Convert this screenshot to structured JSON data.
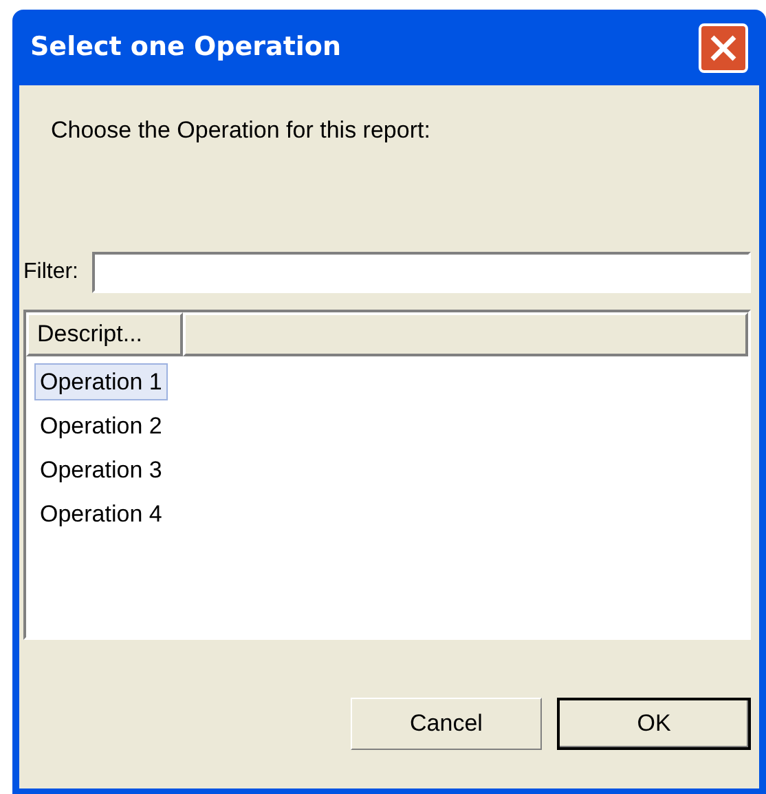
{
  "window": {
    "title": "Select one Operation"
  },
  "prompt": "Choose the Operation for this report:",
  "filter": {
    "label": "Filter:"
  },
  "table": {
    "columns": [
      "Descript..."
    ],
    "rows": [
      {
        "label": "Operation 1",
        "selected": true
      },
      {
        "label": "Operation 2",
        "selected": false
      },
      {
        "label": "Operation 3",
        "selected": false
      },
      {
        "label": "Operation 4",
        "selected": false
      }
    ]
  },
  "buttons": [
    {
      "label": "Cancel",
      "default": false
    },
    {
      "label": "OK",
      "default": true
    }
  ]
}
